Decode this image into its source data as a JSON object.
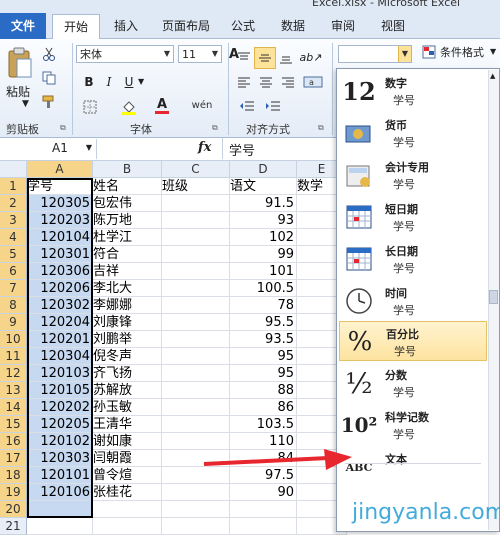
{
  "window_title": "Excel.xlsx - Microsoft Excel",
  "tabs": {
    "file": "文件",
    "home": "开始",
    "insert": "插入",
    "page_layout": "页面布局",
    "formulas": "公式",
    "data": "数据",
    "review": "审阅",
    "view": "视图"
  },
  "ribbon": {
    "paste_label": "粘贴",
    "clipboard_label": "剪贴板",
    "font_name": "宋体",
    "font_size": "11",
    "font_group_label": "字体",
    "bold": "B",
    "italic": "I",
    "underline": "U",
    "font_color_glyph": "A",
    "phonetic_glyph": "wén",
    "alignment_label": "对齐方式",
    "conditional_format_label": "条件格式"
  },
  "formula_bar": {
    "name_box": "A1",
    "fx": "fx",
    "content": "学号"
  },
  "sheet": {
    "columns": [
      "A",
      "B",
      "C",
      "D",
      "E"
    ],
    "row_numbers": [
      "1",
      "2",
      "3",
      "4",
      "5",
      "6",
      "7",
      "8",
      "9",
      "10",
      "11",
      "12",
      "13",
      "14",
      "15",
      "16",
      "17",
      "18",
      "19",
      "20",
      "21"
    ],
    "rows": [
      [
        "学号",
        "姓名",
        "班级",
        "语文",
        "数学"
      ],
      [
        "120305",
        "包宏伟",
        "",
        "91.5",
        ""
      ],
      [
        "120203",
        "陈万地",
        "",
        "93",
        ""
      ],
      [
        "120104",
        "杜学江",
        "",
        "102",
        ""
      ],
      [
        "120301",
        "符合",
        "",
        "99",
        ""
      ],
      [
        "120306",
        "吉祥",
        "",
        "101",
        ""
      ],
      [
        "120206",
        "李北大",
        "",
        "100.5",
        ""
      ],
      [
        "120302",
        "李娜娜",
        "",
        "78",
        ""
      ],
      [
        "120204",
        "刘康锋",
        "",
        "95.5",
        ""
      ],
      [
        "120201",
        "刘鹏举",
        "",
        "93.5",
        ""
      ],
      [
        "120304",
        "倪冬声",
        "",
        "95",
        ""
      ],
      [
        "120103",
        "齐飞扬",
        "",
        "95",
        ""
      ],
      [
        "120105",
        "苏解放",
        "",
        "88",
        ""
      ],
      [
        "120202",
        "孙玉敏",
        "",
        "86",
        ""
      ],
      [
        "120205",
        "王清华",
        "",
        "103.5",
        ""
      ],
      [
        "120102",
        "谢如康",
        "",
        "110",
        ""
      ],
      [
        "120303",
        "闫朝霞",
        "",
        "84",
        ""
      ],
      [
        "120101",
        "曾令煊",
        "",
        "97.5",
        ""
      ],
      [
        "120106",
        "张桂花",
        "",
        "90",
        ""
      ],
      [
        "",
        "",
        "",
        "",
        ""
      ],
      [
        "",
        "",
        "",
        "",
        ""
      ]
    ]
  },
  "format_menu": {
    "items": [
      {
        "title": "数字",
        "sample": "学号",
        "icon": "number-icon",
        "glyph": "12"
      },
      {
        "title": "货币",
        "sample": "学号",
        "icon": "currency-icon",
        "glyph": ""
      },
      {
        "title": "会计专用",
        "sample": "学号",
        "icon": "accounting-icon",
        "glyph": ""
      },
      {
        "title": "短日期",
        "sample": "学号",
        "icon": "short-date-icon",
        "glyph": ""
      },
      {
        "title": "长日期",
        "sample": "学号",
        "icon": "long-date-icon",
        "glyph": ""
      },
      {
        "title": "时间",
        "sample": "学号",
        "icon": "clock-icon",
        "glyph": ""
      },
      {
        "title": "百分比",
        "sample": "学号",
        "icon": "percent-icon",
        "glyph": "%"
      },
      {
        "title": "分数",
        "sample": "学号",
        "icon": "fraction-icon",
        "glyph": "½"
      },
      {
        "title": "科学记数",
        "sample": "学号",
        "icon": "scientific-icon",
        "glyph": "10²"
      },
      {
        "title": "文本",
        "sample": "",
        "icon": "text-abc-icon",
        "glyph": "ABC"
      }
    ],
    "highlighted": "百分比"
  },
  "watermark": "jingyanla.com",
  "colors": {
    "accent": "#2a6cc5",
    "selection": "#c6d9f1",
    "header_selected": "#f6d58a",
    "arrow": "#e8262e"
  }
}
